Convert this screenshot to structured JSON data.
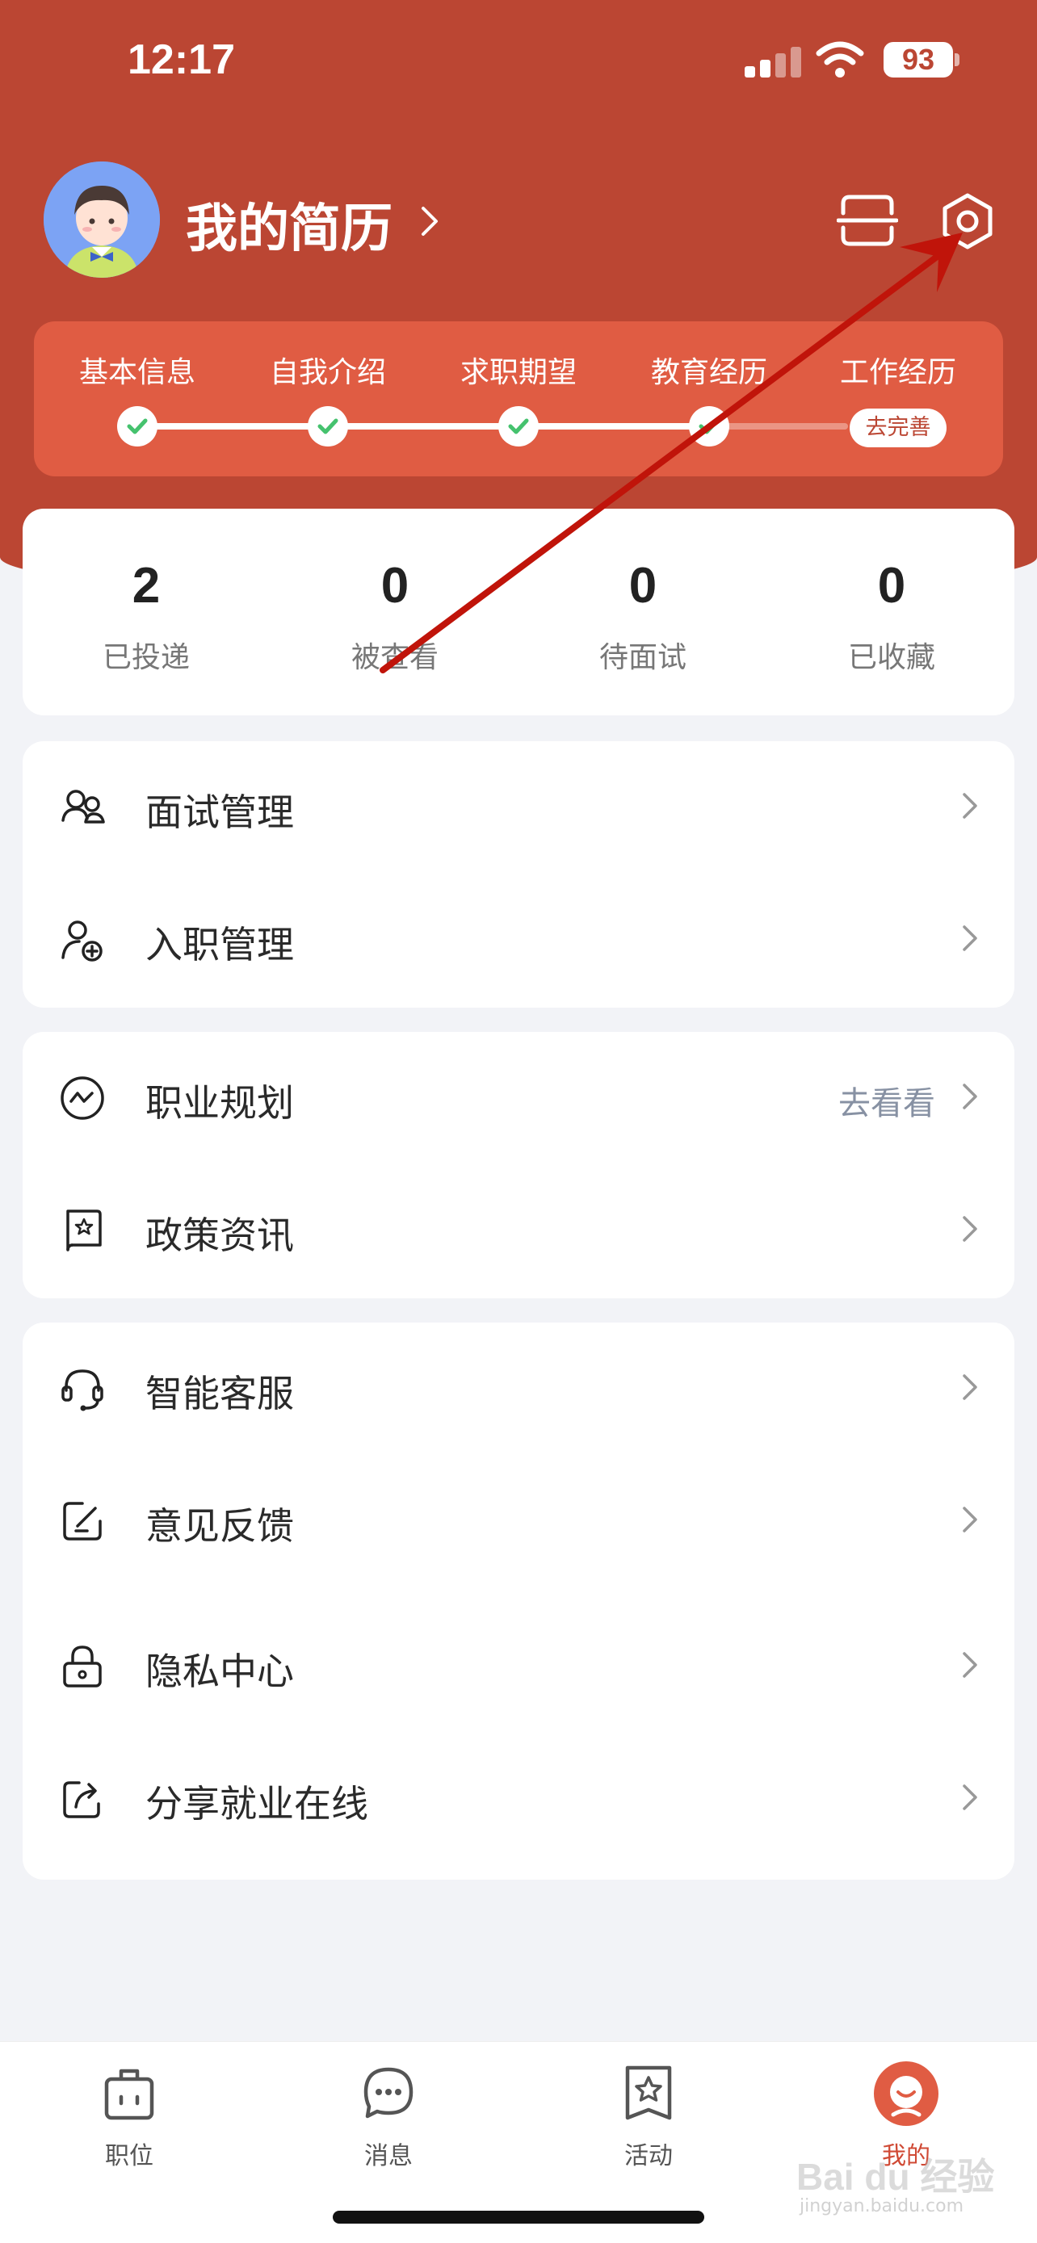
{
  "status_bar": {
    "time": "12:17",
    "battery": "93"
  },
  "header": {
    "title": "我的简历",
    "steps": [
      {
        "label": "基本信息",
        "done": true
      },
      {
        "label": "自我介绍",
        "done": true
      },
      {
        "label": "求职期望",
        "done": true
      },
      {
        "label": "教育经历",
        "done": true
      },
      {
        "label": "工作经历",
        "done": false
      }
    ],
    "complete_button": "去完善"
  },
  "stats": [
    {
      "value": "2",
      "label": "已投递"
    },
    {
      "value": "0",
      "label": "被查看"
    },
    {
      "value": "0",
      "label": "待面试"
    },
    {
      "value": "0",
      "label": "已收藏"
    }
  ],
  "menu_group1": [
    {
      "label": "面试管理",
      "icon": "interview-icon"
    },
    {
      "label": "入职管理",
      "icon": "onboarding-icon"
    }
  ],
  "menu_group2": [
    {
      "label": "职业规划",
      "icon": "career-plan-icon",
      "extra": "去看看"
    },
    {
      "label": "政策资讯",
      "icon": "policy-news-icon"
    }
  ],
  "menu_group3": [
    {
      "label": "智能客服",
      "icon": "headset-icon"
    },
    {
      "label": "意见反馈",
      "icon": "feedback-icon"
    },
    {
      "label": "隐私中心",
      "icon": "lock-icon"
    },
    {
      "label": "分享就业在线",
      "icon": "share-icon"
    }
  ],
  "tabbar": [
    {
      "label": "职位",
      "icon": "briefcase-icon"
    },
    {
      "label": "消息",
      "icon": "chat-bubble-icon"
    },
    {
      "label": "活动",
      "icon": "star-bookmark-icon"
    },
    {
      "label": "我的",
      "icon": "profile-icon",
      "active": true
    }
  ],
  "watermark": {
    "brand": "Bai du 经验",
    "url": "jingyan.baidu.com"
  },
  "colors": {
    "brand": "#bb4633",
    "card_red": "#e05c43",
    "check": "#45c26e",
    "annotation_arrow": "#c0140a"
  }
}
